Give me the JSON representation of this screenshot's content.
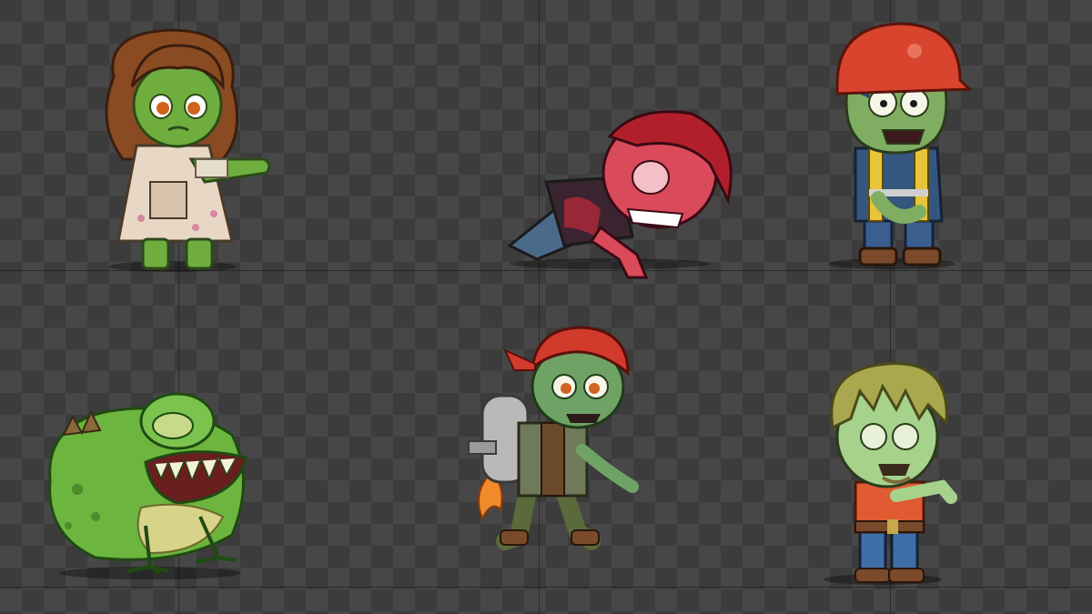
{
  "sheet": {
    "background": "transparency-checkerboard",
    "checker_colors": [
      "#3c3c3c",
      "#474747"
    ],
    "grid_line_color": "#1a1a1a"
  },
  "sprites": [
    {
      "id": "zombie-girl",
      "skin": "#6fae3e",
      "hair": "#8a4a22",
      "dress": "#e8d7c4"
    },
    {
      "id": "crawling-zombie",
      "skin": "#d94a5a",
      "hair": "#b21f2c",
      "shirt": "#3a2430"
    },
    {
      "id": "construction-zombie",
      "skin": "#7fae63",
      "helmet": "#d9442e",
      "vest": "#e8c43a",
      "shirt": "#35577f"
    },
    {
      "id": "zombie-toad",
      "skin": "#6cb53e",
      "belly": "#d7d489"
    },
    {
      "id": "jetpack-zombie",
      "skin": "#6fa366",
      "bandana": "#d23a2c",
      "jetpack": "#b9b9b9",
      "flame": "#f08a2a"
    },
    {
      "id": "blonde-zombie",
      "skin": "#a6d28c",
      "hair": "#a9a84f",
      "shirt": "#e05a32",
      "pants": "#3f6fa8"
    }
  ]
}
